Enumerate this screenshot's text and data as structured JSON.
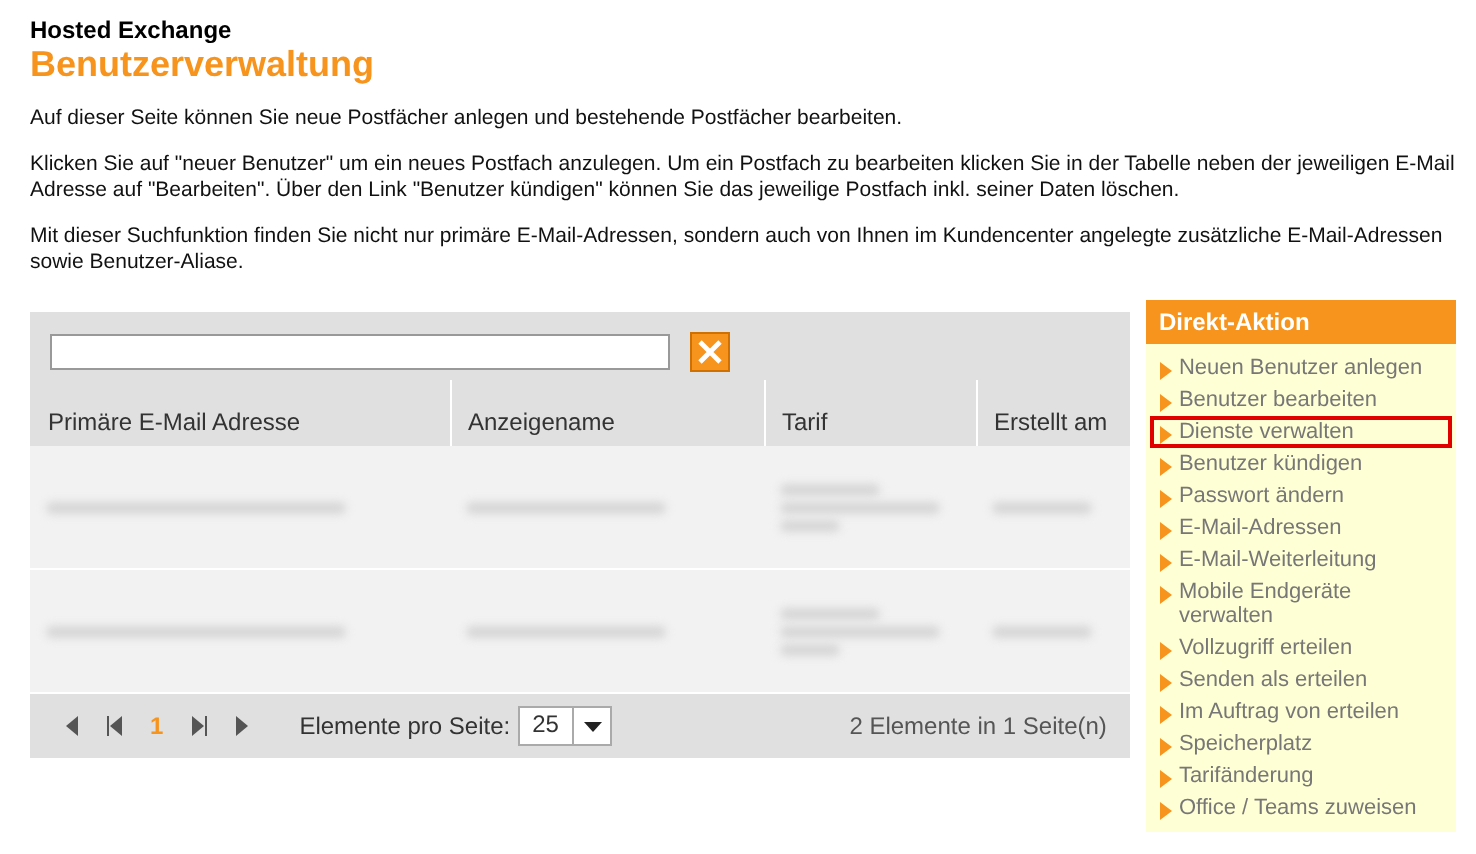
{
  "header": {
    "subtitle": "Hosted Exchange",
    "title": "Benutzerverwaltung"
  },
  "intro": [
    "Auf dieser Seite können Sie neue Postfächer anlegen und bestehende Postfächer bearbeiten.",
    "Klicken Sie auf \"neuer Benutzer\" um ein neues Postfach anzulegen. Um ein Postfach zu bearbeiten klicken Sie in der Tabelle neben der jeweiligen E-Mail Adresse auf \"Bearbeiten\". Über den Link \"Benutzer kündigen\" können Sie das jeweilige Postfach inkl. seiner Daten löschen.",
    "Mit dieser Suchfunktion finden Sie nicht nur primäre E-Mail-Adressen, sondern auch von Ihnen im Kundencenter angelegte zusätzliche E-Mail-Adressen sowie Benutzer-Aliase."
  ],
  "table": {
    "columns": [
      "Primäre E-Mail Adresse",
      "Anzeigename",
      "Tarif",
      "Erstellt am"
    ],
    "rows": [
      {
        "kind": "blurred"
      },
      {
        "kind": "blurred"
      }
    ],
    "pager": {
      "pages": [
        {
          "label": "1",
          "selected": true
        }
      ],
      "page_size_label": "Elemente pro Seite:",
      "page_size": "25",
      "summary": "2 Elemente in 1 Seite(n)"
    }
  },
  "sidebar": {
    "title": "Direkt-Aktion",
    "items": [
      {
        "label": "Neuen Benutzer anlegen",
        "highlighted": false
      },
      {
        "label": "Benutzer bearbeiten",
        "highlighted": false
      },
      {
        "label": "Dienste verwalten",
        "highlighted": true
      },
      {
        "label": "Benutzer kündigen",
        "highlighted": false
      },
      {
        "label": "Passwort ändern",
        "highlighted": false
      },
      {
        "label": "E-Mail-Adressen",
        "highlighted": false
      },
      {
        "label": "E-Mail-Weiterleitung",
        "highlighted": false
      },
      {
        "label": "Mobile Endgeräte verwalten",
        "highlighted": false
      },
      {
        "label": "Vollzugriff erteilen",
        "highlighted": false
      },
      {
        "label": "Senden als erteilen",
        "highlighted": false
      },
      {
        "label": "Im Auftrag von erteilen",
        "highlighted": false
      },
      {
        "label": "Speicherplatz",
        "highlighted": false
      },
      {
        "label": "Tarifänderung",
        "highlighted": false
      },
      {
        "label": "Office / Teams zuweisen",
        "highlighted": false
      }
    ]
  }
}
